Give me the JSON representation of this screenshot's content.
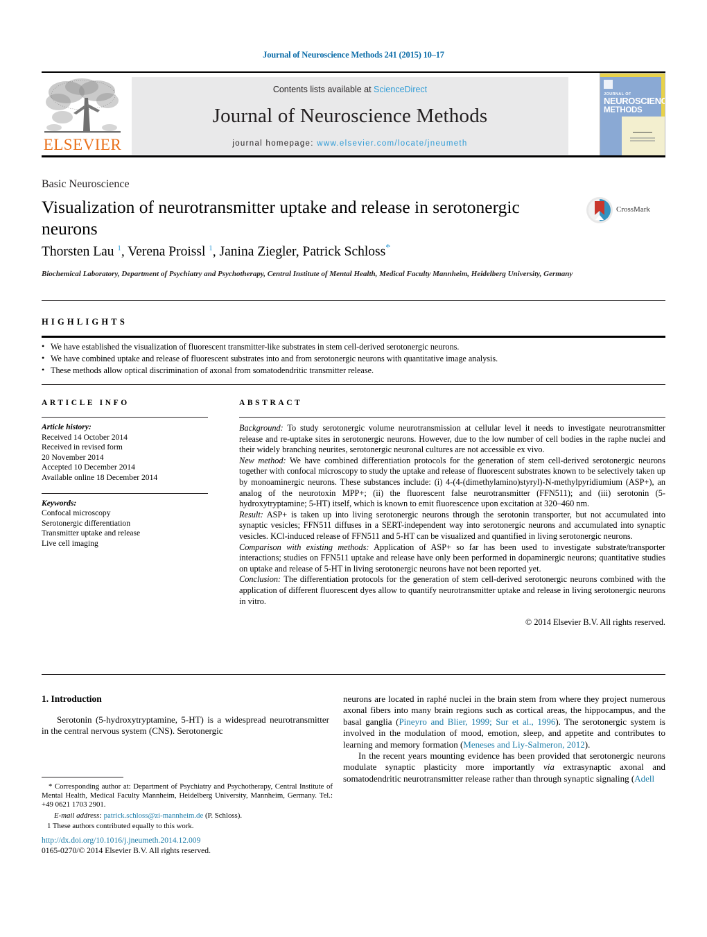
{
  "citation": "Journal of Neuroscience Methods 241 (2015) 10–17",
  "masthead": {
    "publisher": "ELSEVIER",
    "contents_prefix": "Contents lists available at ",
    "contents_link": "ScienceDirect",
    "journal_title": "Journal of Neuroscience Methods",
    "homepage_prefix": "journal homepage: ",
    "homepage_url": "www.elsevier.com/locate/jneumeth",
    "cover": {
      "line1": "JOURNAL OF",
      "line2": "NEUROSCIENCE",
      "line3": "METHODS"
    }
  },
  "article": {
    "section_label": "Basic Neuroscience",
    "title": "Visualization of neurotransmitter uptake and release in serotonergic neurons",
    "crossmark_label": "CrossMark",
    "authors_html": "Thorsten Lau <sup>1</sup>, Verena Proissl <sup>1</sup>, Janina Ziegler, Patrick Schloss<span class=\"star\">*</span>",
    "affiliation": "Biochemical Laboratory, Department of Psychiatry and Psychotherapy, Central Institute of Mental Health, Medical Faculty Mannheim, Heidelberg University, Germany"
  },
  "highlights": {
    "heading": "HIGHLIGHTS",
    "items": [
      "We have established the visualization of fluorescent transmitter-like substrates in stem cell-derived serotonergic neurons.",
      "We have combined uptake and release of fluorescent substrates into and from serotonergic neurons with quantitative image analysis.",
      "These methods allow optical discrimination of axonal from somatodendritic transmitter release."
    ]
  },
  "article_info": {
    "heading": "ARTICLE INFO",
    "history_label": "Article history:",
    "history": [
      "Received 14 October 2014",
      "Received in revised form",
      "20 November 2014",
      "Accepted 10 December 2014",
      "Available online 18 December 2014"
    ],
    "keywords_label": "Keywords:",
    "keywords": [
      "Confocal microscopy",
      "Serotonergic differentiation",
      "Transmitter uptake and release",
      "Live cell imaging"
    ]
  },
  "abstract": {
    "heading": "ABSTRACT",
    "background_label": "Background:",
    "background_text": " To study serotonergic volume neurotransmission at cellular level it needs to investigate neurotransmitter release and re-uptake sites in serotonergic neurons. However, due to the low number of cell bodies in the raphe nuclei and their widely branching neurites, serotonergic neuronal cultures are not accessible ex vivo.",
    "newmethod_label": "New method:",
    "newmethod_text": " We have combined differentiation protocols for the generation of stem cell-derived serotonergic neurons together with confocal microscopy to study the uptake and release of fluorescent substrates known to be selectively taken up by monoaminergic neurons. These substances include: (i) 4-(4-(dimethylamino)styryl)-N-methylpyridiumium (ASP+), an analog of the neurotoxin MPP+; (ii) the fluorescent false neurotransmitter (FFN511); and (iii) serotonin (5-hydroxytryptamine; 5-HT) itself, which is known to emit fluorescence upon excitation at 320–460 nm.",
    "result_label": "Result:",
    "result_text": " ASP+ is taken up into living serotonergic neurons through the serotonin transporter, but not accumulated into synaptic vesicles; FFN511 diffuses in a SERT-independent way into serotonergic neurons and accumulated into synaptic vesicles. KCl-induced release of FFN511 and 5-HT can be visualized and quantified in living serotonergic neurons.",
    "comparison_label": "Comparison with existing methods:",
    "comparison_text": " Application of ASP+ so far has been used to investigate substrate/transporter interactions; studies on FFN511 uptake and release have only been performed in dopaminergic neurons; quantitative studies on uptake and release of 5-HT in living serotonergic neurons have not been reported yet.",
    "conclusion_label": "Conclusion:",
    "conclusion_text": " The differentiation protocols for the generation of stem cell-derived serotonergic neurons combined with the application of different fluorescent dyes allow to quantify neurotransmitter uptake and release in living serotonergic neurons in vitro.",
    "copyright": "© 2014 Elsevier B.V. All rights reserved."
  },
  "body": {
    "intro_heading": "1. Introduction",
    "left_p1": "Serotonin (5-hydroxytryptamine, 5-HT) is a widespread neurotransmitter in the central nervous system (CNS). Serotonergic",
    "right_p1_a": "neurons are located in raphé nuclei in the brain stem from where they project numerous axonal fibers into many brain regions such as cortical areas, the hippocampus, and the basal ganglia (",
    "right_p1_cite1": "Pineyro and Blier, 1999; Sur et al., 1996",
    "right_p1_b": "). The serotonergic system is involved in the modulation of mood, emotion, sleep, and appetite and contributes to learning and memory formation (",
    "right_p1_cite2": "Meneses and Liy-Salmeron, 2012",
    "right_p1_c": ").",
    "right_p2_a": "In the recent years mounting evidence has been provided that serotonergic neurons modulate synaptic plasticity more importantly ",
    "right_p2_ital": "via",
    "right_p2_b": " extrasynaptic axonal and somatodendritic neurotransmitter release rather than through synaptic signaling (",
    "right_p2_cite": "Adell"
  },
  "footnotes": {
    "corresponding": "* Corresponding author at: Department of Psychiatry and Psychotherapy, Central Institute of Mental Health, Medical Faculty Mannheim, Heidelberg University, Mannheim, Germany. Tel.: +49 0621 1703 2901.",
    "email_label": "E-mail address:",
    "email": "patrick.schloss@zi-mannheim.de",
    "email_suffix": " (P. Schloss).",
    "equal_contrib": "1 These authors contributed equally to this work."
  },
  "footer": {
    "doi": "http://dx.doi.org/10.1016/j.jneumeth.2014.12.009",
    "issn": "0165-0270/© 2014 Elsevier B.V. All rights reserved."
  },
  "colors": {
    "link_blue": "#1a7ba8",
    "sciencedirect_blue": "#2e9bd6",
    "elsevier_orange": "#E9711C",
    "cover_blue": "#8aa9d4",
    "crossmark_red": "#c8372d"
  }
}
